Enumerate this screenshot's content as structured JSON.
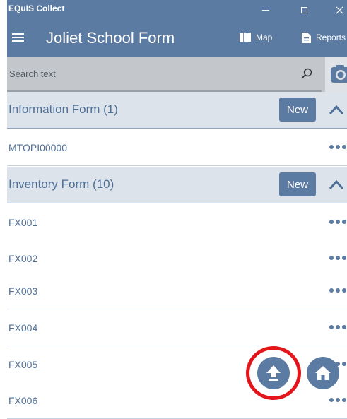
{
  "window": {
    "title": "EQuIS Collect",
    "controls": [
      "minimize",
      "maximize",
      "close"
    ]
  },
  "header": {
    "title": "Joliet School Form",
    "menu_icon": "hamburger-menu-icon",
    "map_label": "Map",
    "map_icon": "map-icon",
    "reports_label": "Reports",
    "reports_icon": "document-icon"
  },
  "search": {
    "placeholder": "Search text",
    "value": "",
    "icon": "search-icon",
    "camera_icon": "camera-icon"
  },
  "sections": [
    {
      "title": "Information Form (1)",
      "new_label": "New",
      "collapse_icon": "chevron-up-icon",
      "items": [
        {
          "label": "MTOPI00000",
          "menu_icon": "more-horizontal-icon"
        }
      ]
    },
    {
      "title": "Inventory Form (10)",
      "new_label": "New",
      "collapse_icon": "chevron-up-icon",
      "items": [
        {
          "label": "FX001",
          "menu_icon": "more-horizontal-icon"
        },
        {
          "label": "FX002",
          "menu_icon": "more-horizontal-icon"
        },
        {
          "label": "FX003",
          "menu_icon": "more-horizontal-icon"
        },
        {
          "label": "FX004",
          "menu_icon": "more-horizontal-icon"
        },
        {
          "label": "FX005",
          "menu_icon": "more-horizontal-icon"
        },
        {
          "label": "FX006",
          "menu_icon": "more-horizontal-icon"
        }
      ]
    }
  ],
  "fabs": {
    "upload_icon": "upload-arrow-icon",
    "home_icon": "home-icon",
    "highlight_color": "#e3161b"
  },
  "colors": {
    "accent": "#5b7ba3",
    "section_bg": "#dce3ea",
    "search_bg": "#c3c7cc",
    "text_link": "#4f6f96"
  }
}
